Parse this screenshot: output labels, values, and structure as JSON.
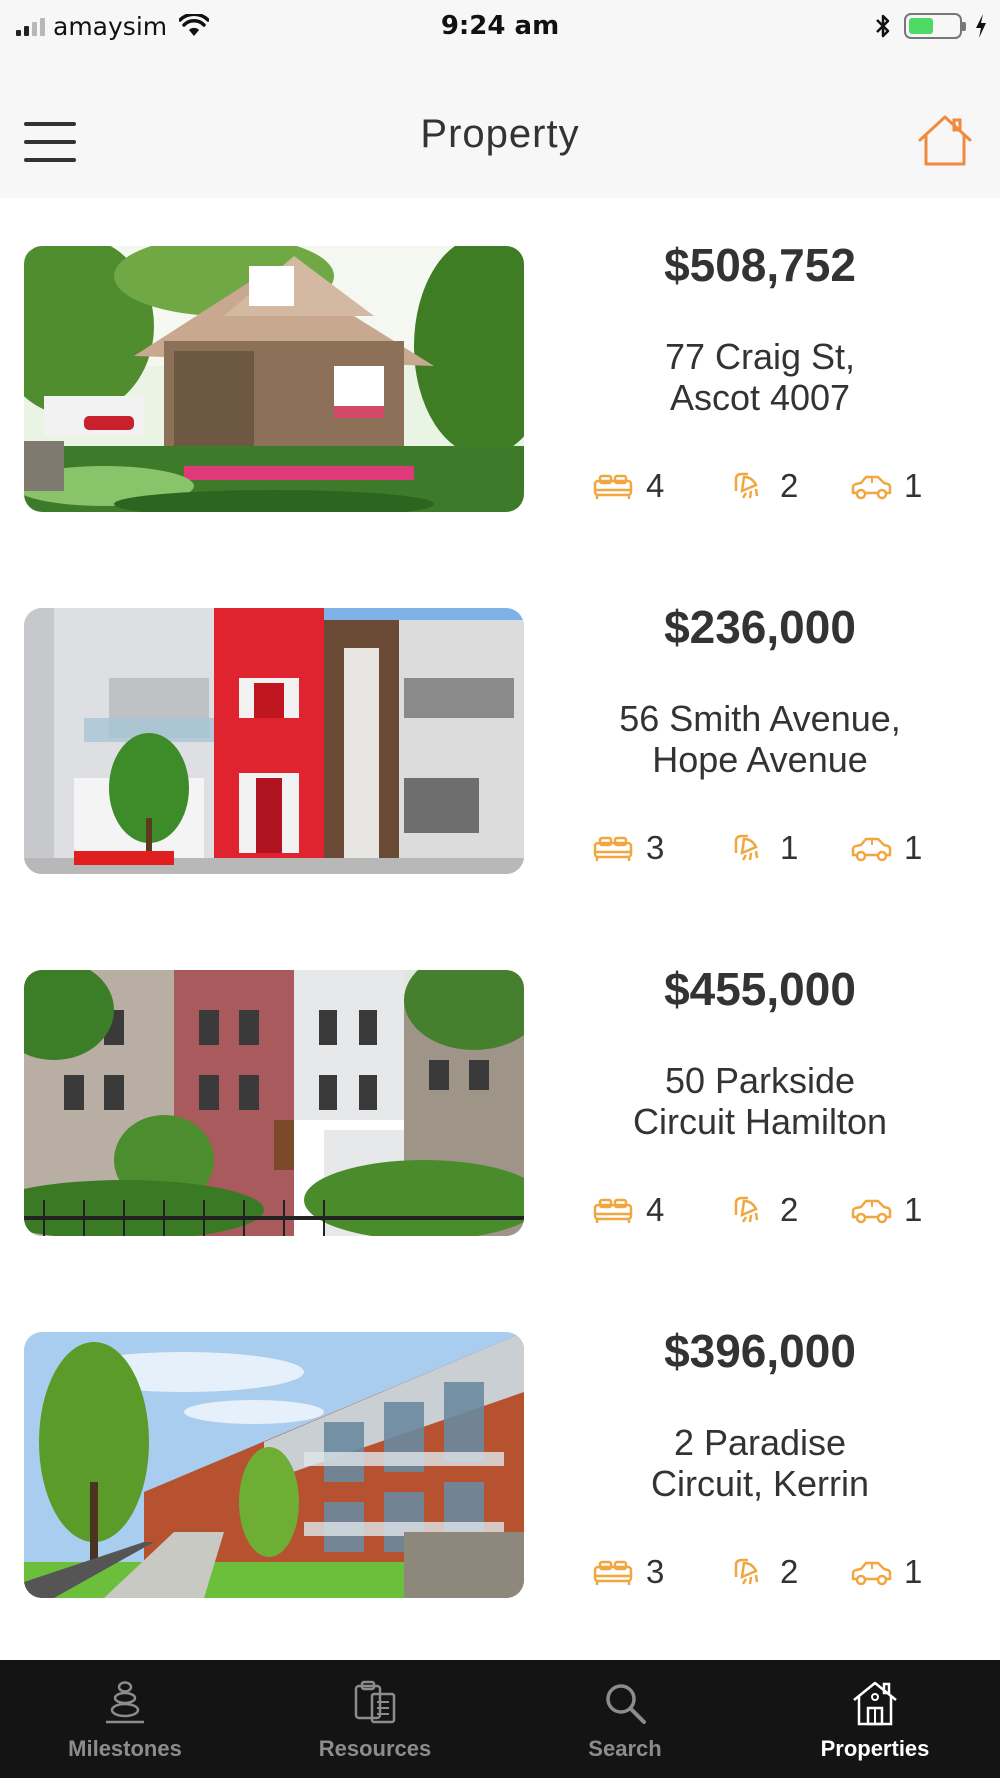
{
  "status_bar": {
    "carrier": "amaysim",
    "time": "9:24 am",
    "battery_level": 0.5,
    "icons": [
      "signal-icon",
      "wifi-icon",
      "bluetooth-icon",
      "battery-icon",
      "charging-icon"
    ]
  },
  "header": {
    "title": "Property",
    "left_icon": "hamburger-menu-icon",
    "right_icon": "home-icon",
    "accent_color": "#f08a3c"
  },
  "properties": [
    {
      "price": "$508,752",
      "address_line1": "77 Craig St,",
      "address_line2": "Ascot 4007",
      "beds": "4",
      "baths": "2",
      "cars": "1"
    },
    {
      "price": "$236,000",
      "address_line1": "56 Smith Avenue,",
      "address_line2": "Hope Avenue",
      "beds": "3",
      "baths": "1",
      "cars": "1"
    },
    {
      "price": "$455,000",
      "address_line1": "50 Parkside",
      "address_line2": "Circuit Hamilton",
      "beds": "4",
      "baths": "2",
      "cars": "1"
    },
    {
      "price": "$396,000",
      "address_line1": "2 Paradise",
      "address_line2": "Circuit, Kerrin",
      "beds": "3",
      "baths": "2",
      "cars": "1"
    }
  ],
  "feature_icon_color": "#f0a740",
  "tabs": [
    {
      "label": "Milestones",
      "icon": "milestones-stones-icon",
      "active": false
    },
    {
      "label": "Resources",
      "icon": "resources-clipboard-icon",
      "active": false
    },
    {
      "label": "Search",
      "icon": "search-icon",
      "active": false
    },
    {
      "label": "Properties",
      "icon": "properties-house-icon",
      "active": true
    }
  ]
}
